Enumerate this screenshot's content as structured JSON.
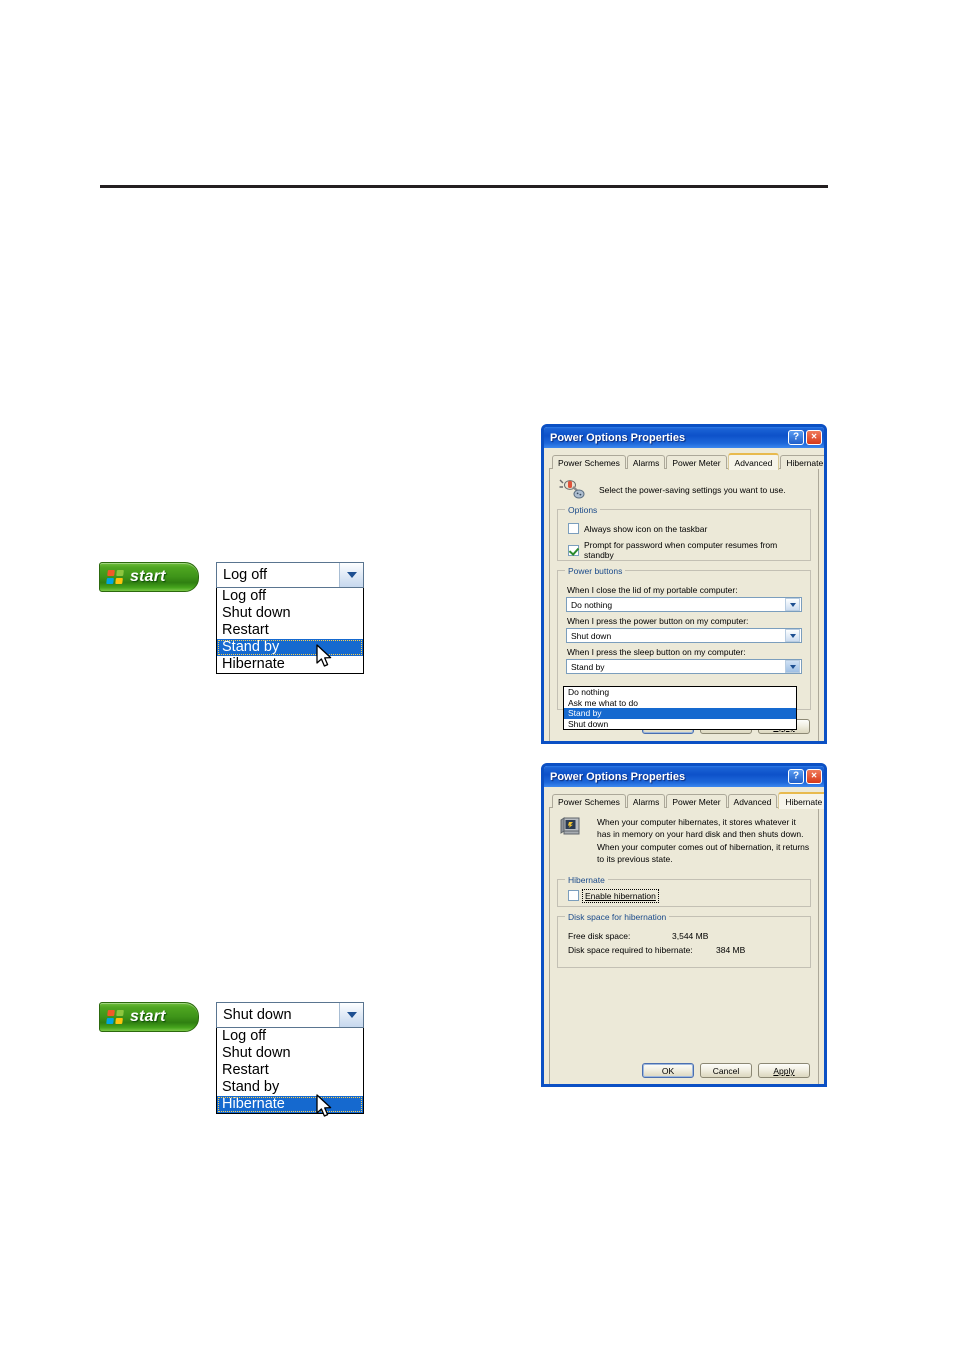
{
  "page": {
    "background": "#ffffff",
    "rule_color": "#231f20"
  },
  "start_menu_examples": [
    {
      "id": "standby",
      "start_label": "start",
      "combo_value": "Log off",
      "options": [
        "Log off",
        "Shut down",
        "Restart",
        "Stand by",
        "Hibernate"
      ],
      "selected_index": 3
    },
    {
      "id": "hibernate",
      "start_label": "start",
      "combo_value": "Shut down",
      "options": [
        "Log off",
        "Shut down",
        "Restart",
        "Stand by",
        "Hibernate"
      ],
      "selected_index": 4
    }
  ],
  "dialog_advanced": {
    "title": "Power Options Properties",
    "help_glyph": "?",
    "close_glyph": "×",
    "tabs": [
      "Power Schemes",
      "Alarms",
      "Power Meter",
      "Advanced",
      "Hibernate"
    ],
    "active_tab_index": 3,
    "intro": "Select the power-saving settings you want to use.",
    "options_group": {
      "title": "Options",
      "checkboxes": [
        {
          "label": "Always show icon on the taskbar",
          "checked": false
        },
        {
          "label": "Prompt for password when computer resumes from standby",
          "checked": true
        }
      ]
    },
    "power_buttons_group": {
      "title": "Power buttons",
      "fields": [
        {
          "label": "When I close the lid of my portable computer:",
          "value": "Do nothing",
          "open": false
        },
        {
          "label": "When I press the power button on my computer:",
          "value": "Shut down",
          "open": false
        },
        {
          "label": "When I press the sleep button on my computer:",
          "value": "Stand by",
          "open": true
        }
      ],
      "open_dropdown": {
        "options": [
          "Do nothing",
          "Ask me what to do",
          "Stand by",
          "Shut down"
        ],
        "selected_index": 2
      }
    },
    "buttons": {
      "ok": "OK",
      "cancel": "Cancel",
      "apply": "Apply"
    }
  },
  "dialog_hibernate": {
    "title": "Power Options Properties",
    "help_glyph": "?",
    "close_glyph": "×",
    "tabs": [
      "Power Schemes",
      "Alarms",
      "Power Meter",
      "Advanced",
      "Hibernate"
    ],
    "active_tab_index": 4,
    "intro": "When your computer hibernates, it stores whatever it has in memory on your hard disk and then shuts down. When your computer comes out of hibernation, it returns to its previous state.",
    "hibernate_group": {
      "title": "Hibernate",
      "checkbox": {
        "label": "Enable hibernation",
        "checked": false
      }
    },
    "disk_group": {
      "title": "Disk space for hibernation",
      "rows": [
        {
          "key": "Free disk space:",
          "value": "3,544 MB"
        },
        {
          "key": "Disk space required to hibernate:",
          "value": "384 MB"
        }
      ]
    },
    "buttons": {
      "ok": "OK",
      "cancel": "Cancel",
      "apply": "Apply"
    }
  },
  "colors": {
    "title_bar": "#0d51c9",
    "dialog_face": "#ece9d8",
    "selection": "#1569cf",
    "group_label": "#1a4a8a",
    "start_green": "#3f9519"
  }
}
